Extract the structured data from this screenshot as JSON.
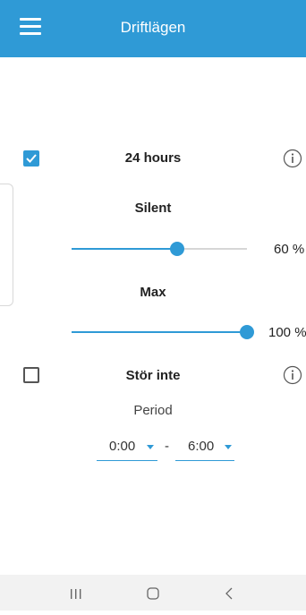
{
  "app_bar": {
    "title": "Driftlägen",
    "menu_icon": "hamburger-menu-icon",
    "background": "#2f9ad6"
  },
  "modes": {
    "hours24": {
      "label": "24 hours",
      "checked": true,
      "info_icon": "info-icon"
    },
    "silent": {
      "label": "Silent",
      "value_label": "60 %",
      "value_percent": 60
    },
    "max": {
      "label": "Max",
      "value_label": "100 %",
      "value_percent": 100
    },
    "do_not_disturb": {
      "label": "Stör inte",
      "checked": false,
      "info_icon": "info-icon"
    }
  },
  "period": {
    "label": "Period",
    "from": "0:00",
    "separator": "-",
    "to": "6:00"
  },
  "nav_bar": {
    "recent_icon": "recent-apps-icon",
    "home_icon": "home-icon",
    "back_icon": "back-icon"
  },
  "colors": {
    "accent": "#2f9ad6"
  }
}
